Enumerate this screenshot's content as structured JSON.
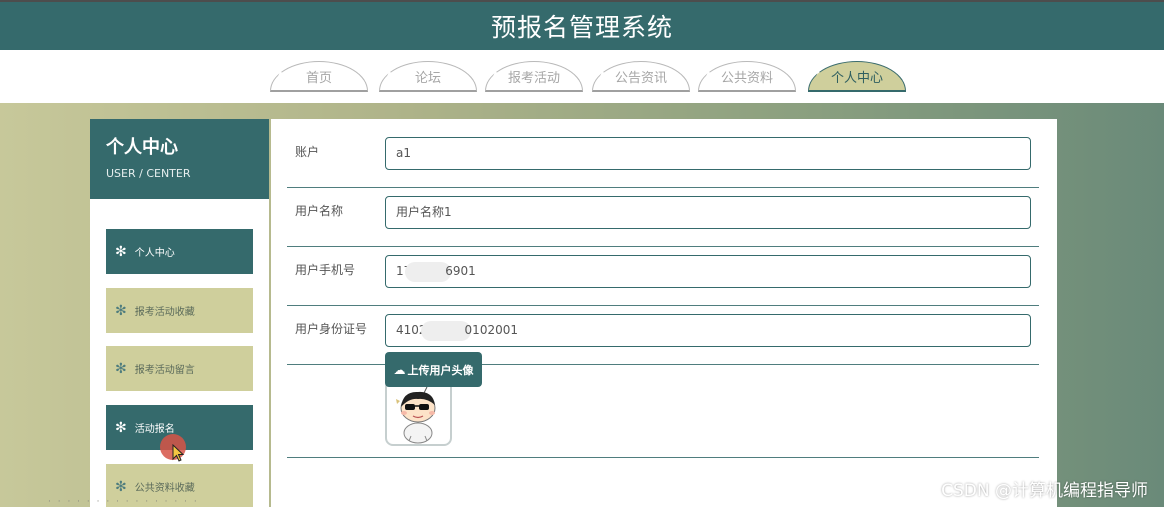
{
  "app": {
    "title": "预报名管理系统"
  },
  "nav": {
    "tabs": [
      {
        "label": "首页"
      },
      {
        "label": "论坛"
      },
      {
        "label": "报考活动"
      },
      {
        "label": "公告资讯"
      },
      {
        "label": "公共资料"
      },
      {
        "label": "个人中心"
      }
    ],
    "active_tab": "个人中心"
  },
  "sidebar": {
    "title": "个人中心",
    "subtitle": "USER / CENTER",
    "items": [
      {
        "label": "个人中心"
      },
      {
        "label": "报考活动收藏"
      },
      {
        "label": "报考活动留言"
      },
      {
        "label": "活动报名"
      },
      {
        "label": "公共资料收藏"
      }
    ],
    "active_items": [
      "个人中心",
      "活动报名"
    ]
  },
  "form": {
    "account": {
      "label": "账户",
      "value": "a1"
    },
    "username": {
      "label": "用户名称",
      "value": "用户名称1"
    },
    "phone": {
      "label": "用户手机号",
      "value_prefix": "17",
      "value_suffix": "6901"
    },
    "idcard": {
      "label": "用户身份证号",
      "value_prefix": "4102",
      "value_suffix": "0102001"
    },
    "upload_button": "上传用户头像"
  },
  "watermark": "CSDN @计算机编程指导师",
  "colors": {
    "primary": "#356a6c",
    "accent": "#cfcf9c",
    "white": "#ffffff"
  },
  "icons": {
    "bullet": "snowflake-icon",
    "upload": "cloud-upload-icon"
  }
}
